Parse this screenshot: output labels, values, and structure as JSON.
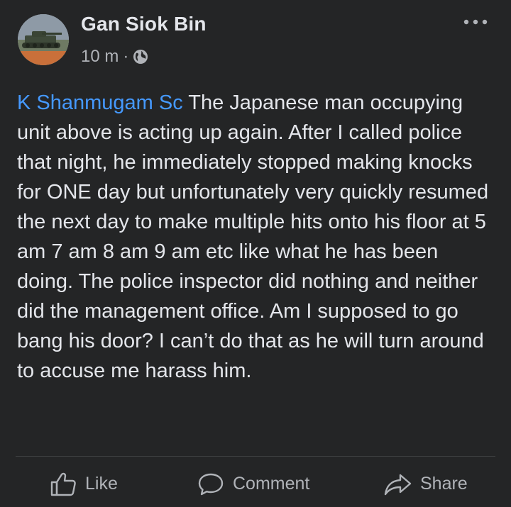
{
  "post": {
    "author": "Gan Siok Bin",
    "time": "10 m",
    "separator": "·",
    "privacy_icon": "globe-icon",
    "more_icon": "more-options-icon",
    "mention": "K Shanmugam Sc",
    "body": " The Japanese man occupying unit above is acting up again. After I called police that night, he immediately stopped making knocks for ONE day but unfortunately very quickly resumed the next day to make multiple hits onto his floor at 5 am 7 am 8 am 9 am etc like what he has been doing. The police inspector did nothing and neither did the management office. Am I supposed to go bang his door? I can’t do that as he will turn around to accuse me harass him."
  },
  "actions": {
    "like": "Like",
    "comment": "Comment",
    "share": "Share"
  },
  "colors": {
    "background": "#242526",
    "text": "#e4e6eb",
    "secondary_text": "#b0b3b8",
    "mention": "#4599ff",
    "divider": "#3e4042"
  }
}
